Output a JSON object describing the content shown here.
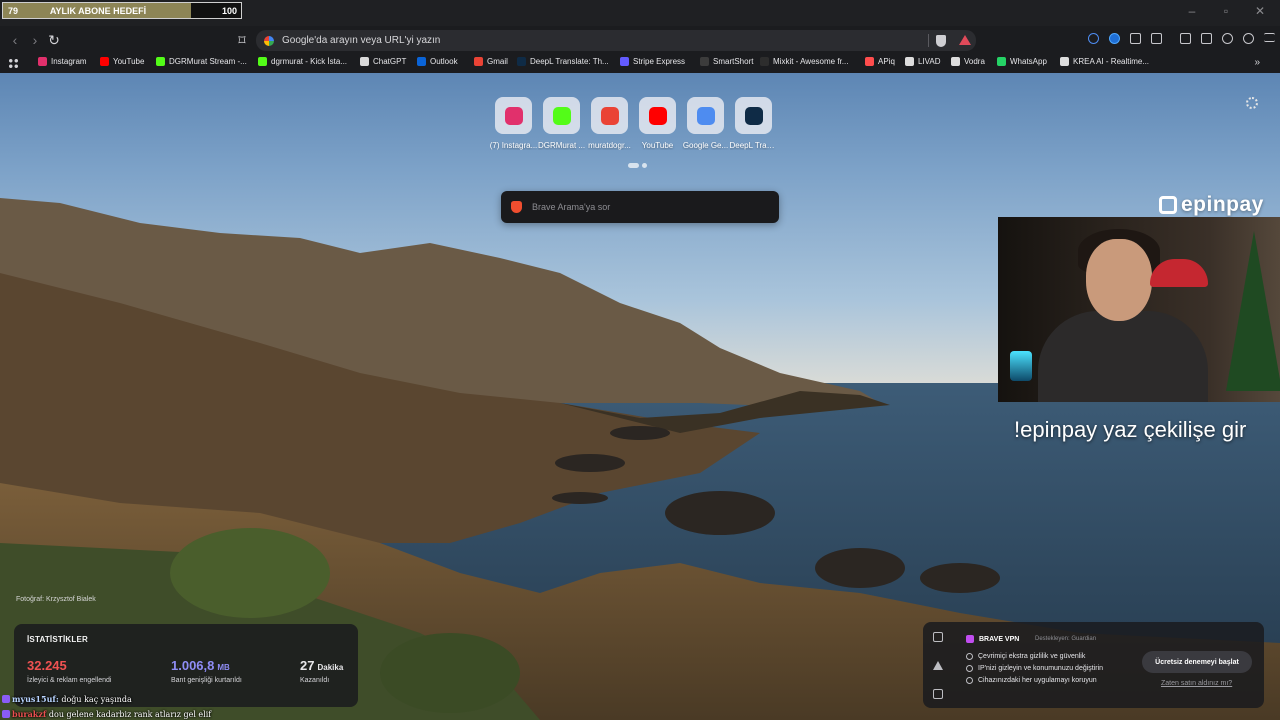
{
  "stream_goal": {
    "current": "79",
    "label": "AYLIK ABONE HEDEFİ",
    "target": "100",
    "progress": 0.79
  },
  "toolbar": {
    "address_placeholder": "Google'da arayın veya URL'yi yazın"
  },
  "bookmarks": [
    {
      "label": "Instagram",
      "color": "#e1306c"
    },
    {
      "label": "YouTube",
      "color": "#ff0000"
    },
    {
      "label": "DGRMurat Stream -...",
      "color": "#53fc18"
    },
    {
      "label": "dgrmurat - Kick İsta...",
      "color": "#53fc18"
    },
    {
      "label": "ChatGPT",
      "color": "#d9d9d9"
    },
    {
      "label": "Outlook",
      "color": "#0a64d8"
    },
    {
      "label": "Gmail",
      "color": "#ea4335"
    },
    {
      "label": "DeepL Translate: Th...",
      "color": "#0f2b46"
    },
    {
      "label": "Stripe Express",
      "color": "#635bff"
    },
    {
      "label": "SmartShort",
      "color": "#3c3c3c"
    },
    {
      "label": "Mixkit - Awesome fr...",
      "color": "#2d2d2d"
    },
    {
      "label": "APiq",
      "color": "#ff4d4d"
    },
    {
      "label": "LIVAD",
      "color": "#dddddd"
    },
    {
      "label": "Vodra",
      "color": "#dddddd"
    },
    {
      "label": "WhatsApp",
      "color": "#25d366"
    },
    {
      "label": "KREA AI - Realtime...",
      "color": "#dddddd"
    }
  ],
  "top_sites": [
    {
      "label": "(7) Instagra...",
      "icon": "instagram-icon",
      "color": "#e1306c"
    },
    {
      "label": "DGRMurat ...",
      "icon": "kick-icon",
      "color": "#53fc18"
    },
    {
      "label": "muratdogr...",
      "icon": "gmail-icon",
      "color": "#ea4335"
    },
    {
      "label": "YouTube",
      "icon": "youtube-icon",
      "color": "#ff0000"
    },
    {
      "label": "Google Ge...",
      "icon": "gemini-icon",
      "color": "#4e8cf0"
    },
    {
      "label": "DeepL Tran...",
      "icon": "deepl-icon",
      "color": "#0f2b46"
    }
  ],
  "search": {
    "placeholder": "Brave Arama'ya sor"
  },
  "photo_credit": "Fotoğraf: Krzysztof Bialek",
  "stats": {
    "title": "İSTATİSTİKLER",
    "blocked": {
      "value": "32.245",
      "desc": "İzleyici & reklam engellendi",
      "color": "#f05252"
    },
    "bandwidth": {
      "value": "1.006,8",
      "unit": "MB",
      "desc": "Bant genişliği kurtarıldı",
      "color": "#8f8df5"
    },
    "time": {
      "value": "27",
      "unit": "Dakika",
      "desc": "Kazanıldı",
      "color": "#ffffff"
    }
  },
  "vpn": {
    "brand": "BRAVE VPN",
    "sponsor": "Destekleyen: Guardian",
    "features": [
      "Çevrimiçi ekstra gizlilik ve güvenlik",
      "IP'nizi gizleyin ve konumunuzu değiştirin",
      "Cihazınızdaki her uygulamayı koruyun"
    ],
    "cta": "Ücretsiz denemeyi başlat",
    "link": "Zaten satın aldınız mı?"
  },
  "overlay": {
    "logo_text": "epinpay",
    "promo": "!epinpay yaz çekilişe gir"
  },
  "chat": [
    {
      "user": "myus15uf:",
      "text": "doğu kaç yaşında"
    },
    {
      "user": "burakzf",
      "text": "dou gelene kadarbiz rank atlarız gel elif"
    }
  ]
}
